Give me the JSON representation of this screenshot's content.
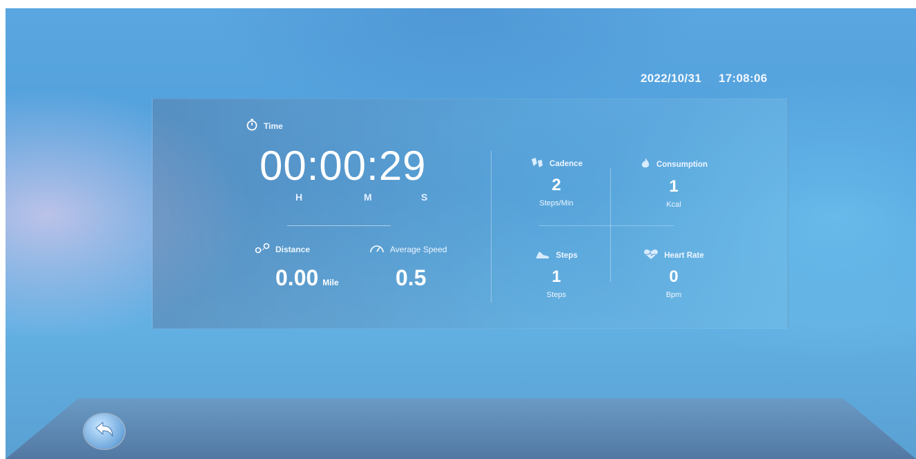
{
  "status": {
    "date": "2022/10/31",
    "time": "17:08:06"
  },
  "time": {
    "label": "Time",
    "value": "00:00:29",
    "h": "H",
    "m": "M",
    "s": "S"
  },
  "distance": {
    "label": "Distance",
    "value": "0.00",
    "unit": "Mile"
  },
  "average_speed": {
    "label": "Average Speed",
    "value": "0.5"
  },
  "cadence": {
    "label": "Cadence",
    "value": "2",
    "unit": "Steps/Min"
  },
  "consumption": {
    "label": "Consumption",
    "value": "1",
    "unit": "Kcal"
  },
  "steps": {
    "label": "Steps",
    "value": "1",
    "unit": "Steps"
  },
  "heart_rate": {
    "label": "Heart Rate",
    "value": "0",
    "unit": "Bpm"
  },
  "icons": [
    "stopwatch-icon",
    "distance-icon",
    "speedometer-icon",
    "cadence-icon",
    "flame-icon",
    "shoe-icon",
    "heart-icon",
    "back-arrow-icon"
  ]
}
